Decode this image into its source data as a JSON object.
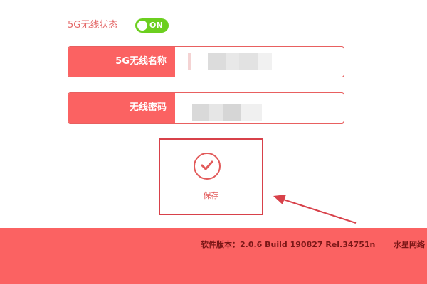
{
  "status": {
    "label": "5G无线状态",
    "toggle_text": "ON"
  },
  "fields": {
    "ssid_label": "5G无线名称",
    "ssid_value": "",
    "password_label": "无线密码",
    "password_value": ""
  },
  "save": {
    "label": "保存"
  },
  "footer": {
    "version": "软件版本：2.0.6 Build 190827 Rel.34751n",
    "brand": "水星网络"
  },
  "colors": {
    "brand_red": "#fb6262",
    "toggle_green": "#6ccf1f",
    "annotation_red": "#d8414a"
  }
}
